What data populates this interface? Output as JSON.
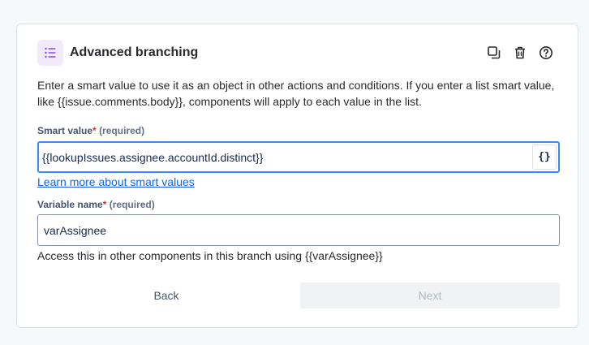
{
  "header": {
    "title": "Advanced branching",
    "icons": [
      "list-icon",
      "copy-icon",
      "trash-icon",
      "help-icon"
    ]
  },
  "description": "Enter a smart value to use it as an object in other actions and conditions. If you enter a list smart value, like {{issue.comments.body}}, components will apply to each value in the list.",
  "smart_value": {
    "label": "Smart value",
    "required_star": "*",
    "required_text": "(required)",
    "value": "{{lookupIssues.assignee.accountId.distinct}}",
    "brace_button": "{}",
    "link": "Learn more about smart values"
  },
  "variable_name": {
    "label": "Variable name",
    "required_star": "*",
    "required_text": "(required)",
    "value": "varAssignee",
    "helper": "Access this in other components in this branch using {{varAssignee}}"
  },
  "buttons": {
    "back": "Back",
    "next": "Next"
  },
  "colors": {
    "accent": "#388bff",
    "link": "#0c66e4",
    "icon_bg": "#f3e9fc",
    "icon": "#8f4bd9"
  }
}
